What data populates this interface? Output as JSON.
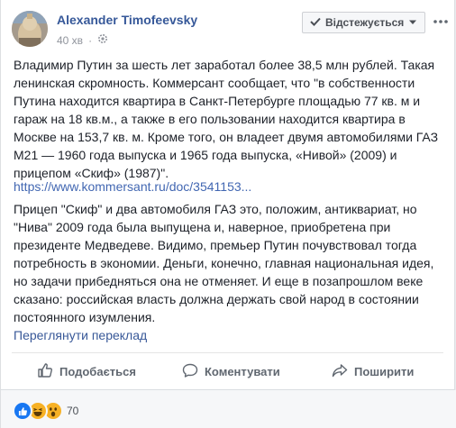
{
  "post": {
    "author": "Alexander Timofeevsky",
    "time": "40 хв",
    "privacy_icon": "gear-icon",
    "follow_label": "Відстежується",
    "paragraph1": "Владимир Путин за шесть лет заработал более 38,5 млн рублей. Такая ленинская скромность. Коммерсант сообщает, что \"в собственности Путина находится квартира в Санкт-Петербурге площадью 77 кв. м и гараж на 18 кв.м., а также в его пользовании находится квартира в Москве на 153,7 кв. м. Кроме того, он владеет двумя автомобилями ГАЗ М21 — 1960 года выпуска и 1965 года выпуска, «Нивой» (2009) и прицепом «Скиф» (1987)\".",
    "link": "https://www.kommersant.ru/doc/3541153...",
    "paragraph2": "Прицеп \"Скиф\" и два автомобиля ГАЗ это, положим, антиквариат, но \"Нива\" 2009 года была выпущена и, наверное, приобретена при президенте Медведеве. Видимо, премьер Путин почувствовал тогда потребность в экономии. Деньги, конечно, главная национальная идея, но задачи прибедняться она не отменяет. И еще в позапрошлом веке сказано: российская власть должна держать свой народ в состоянии постоянного изумления.",
    "translate": "Переглянути переклад"
  },
  "actions": {
    "like": "Подобається",
    "comment": "Коментувати",
    "share": "Поширити"
  },
  "reactions": {
    "icons": [
      "like-icon",
      "haha-icon",
      "wow-icon"
    ],
    "count": "70"
  },
  "colors": {
    "link": "#4267b2",
    "author": "#365899",
    "like_blue": "#1877f2",
    "emoji_yellow": "#f7b125"
  }
}
